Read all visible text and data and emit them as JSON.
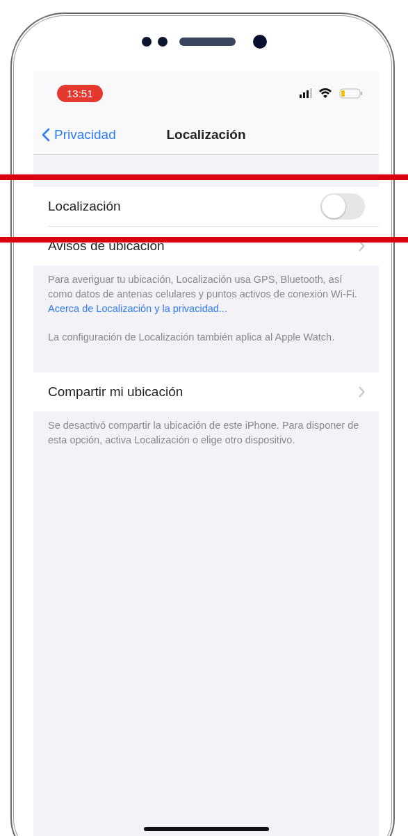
{
  "status_bar": {
    "time": "13:51"
  },
  "nav": {
    "back": "Privacidad",
    "title": "Localización"
  },
  "sections": [
    {
      "rows": [
        {
          "kind": "toggle",
          "label": "Localización",
          "on": false
        },
        {
          "kind": "link",
          "label": "Avisos de ubicación"
        }
      ],
      "footer": [
        {
          "text": "Para averiguar tu ubicación, Localización usa GPS, Bluetooth, así como datos de antenas celulares y puntos activos de conexión Wi-Fi. ",
          "link": "Acerca de Localización y la privacidad..."
        },
        {
          "text": "La configuración de Localización también aplica al Apple Watch."
        }
      ]
    },
    {
      "rows": [
        {
          "kind": "link",
          "label": "Compartir mi ubicación"
        }
      ],
      "footer": [
        {
          "text": "Se desactivó compartir la ubicación de este iPhone. Para disponer de esta opción, activa Localización o elige otro dispositivo."
        }
      ]
    }
  ]
}
